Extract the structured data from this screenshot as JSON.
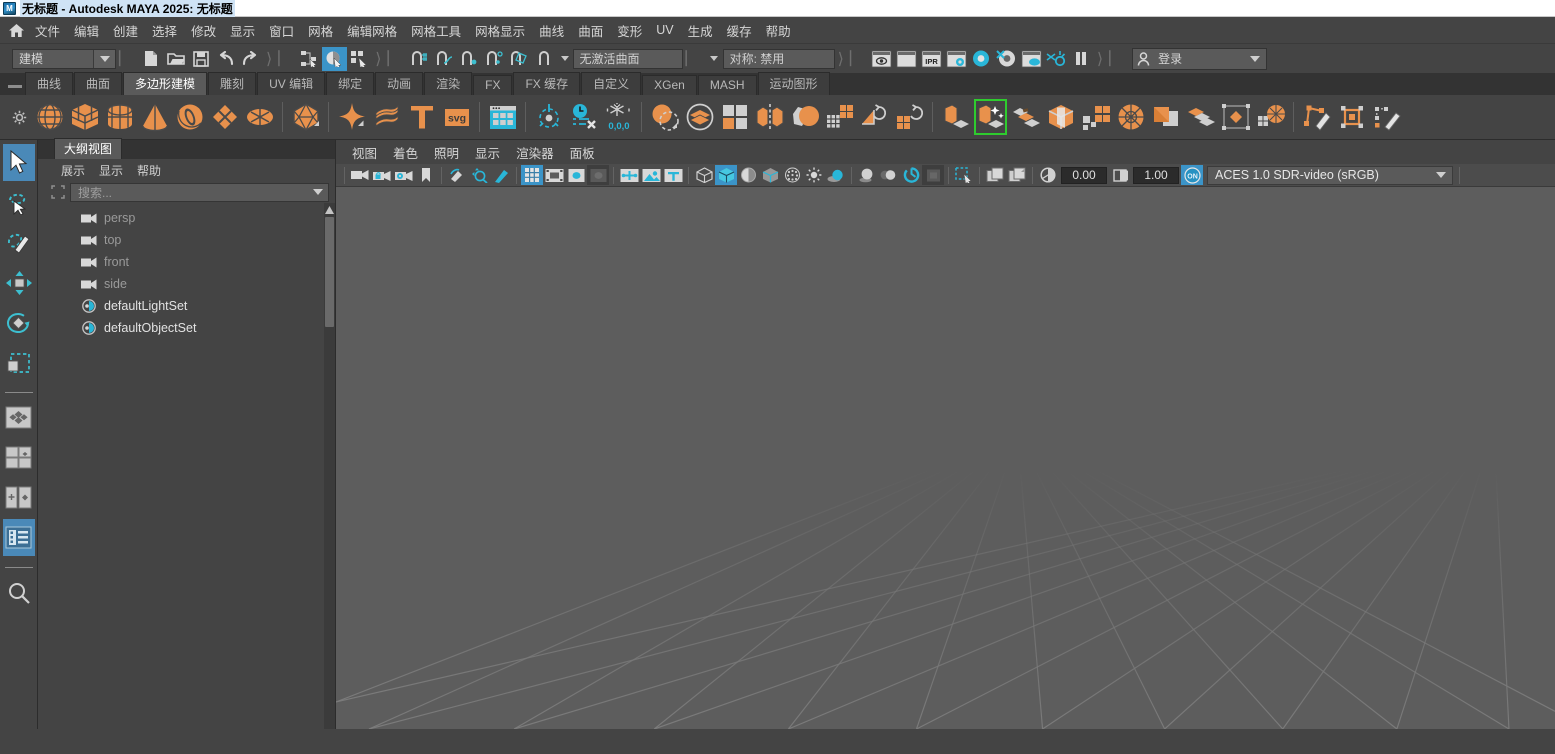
{
  "window": {
    "title": "无标题 - Autodesk MAYA 2025: 无标题",
    "app_icon": "maya-icon"
  },
  "menubar": {
    "home_icon": "home-icon",
    "items": [
      {
        "label": "文件"
      },
      {
        "label": "编辑"
      },
      {
        "label": "创建"
      },
      {
        "label": "选择"
      },
      {
        "label": "修改"
      },
      {
        "label": "显示"
      },
      {
        "label": "窗口"
      },
      {
        "label": "网格"
      },
      {
        "label": "编辑网格"
      },
      {
        "label": "网格工具"
      },
      {
        "label": "网格显示"
      },
      {
        "label": "曲线"
      },
      {
        "label": "曲面"
      },
      {
        "label": "变形"
      },
      {
        "label": "UV"
      },
      {
        "label": "生成"
      },
      {
        "label": "缓存"
      },
      {
        "label": "帮助"
      }
    ]
  },
  "statusbar": {
    "mode_selector": {
      "value": "建模",
      "icon": "chevron-down-icon"
    },
    "file_buttons": [
      {
        "name": "new-scene-button",
        "icon": "new-file-icon"
      },
      {
        "name": "open-scene-button",
        "icon": "open-folder-icon"
      },
      {
        "name": "save-scene-button",
        "icon": "save-disk-icon"
      },
      {
        "name": "undo-button",
        "icon": "undo-arrow-icon"
      },
      {
        "name": "redo-button",
        "icon": "redo-arrow-icon"
      }
    ],
    "selection_mask_buttons": [
      {
        "name": "select-by-hierarchy-button",
        "icon": "hierarchy-select-icon",
        "active": false
      },
      {
        "name": "select-by-object-type-button",
        "icon": "object-select-icon",
        "active": true
      },
      {
        "name": "select-by-component-type-button",
        "icon": "component-select-icon",
        "active": false
      }
    ],
    "snap_buttons": [
      {
        "name": "snap-to-grid-button",
        "icon": "snap-grid-icon"
      },
      {
        "name": "snap-to-curve-button",
        "icon": "snap-curve-icon"
      },
      {
        "name": "snap-to-point-button",
        "icon": "snap-point-icon"
      },
      {
        "name": "snap-to-projected-center-button",
        "icon": "snap-projected-center-icon"
      },
      {
        "name": "snap-to-view-plane-button",
        "icon": "snap-view-plane-icon"
      },
      {
        "name": "make-live-button",
        "icon": "make-live-icon"
      }
    ],
    "live_surface_value": "无激活曲面",
    "symmetry_value": "对称: 禁用",
    "render_buttons": [
      {
        "name": "render-current-frame-button",
        "icon": "render-eye-icon"
      },
      {
        "name": "redo-previous-render-button",
        "icon": "render-blank-icon"
      },
      {
        "name": "ipr-render-button",
        "icon": "ipr-icon"
      },
      {
        "name": "render-settings-button",
        "icon": "render-settings-icon"
      },
      {
        "name": "hypershade-button",
        "icon": "hypershade-icon"
      },
      {
        "name": "render-view-button",
        "icon": "render-view-icon"
      },
      {
        "name": "render-setup-button",
        "icon": "render-setup-icon"
      },
      {
        "name": "toggle-light-linking-button",
        "icon": "light-link-icon"
      },
      {
        "name": "pause-viewport-button",
        "icon": "pause-icon"
      }
    ],
    "account": {
      "label": "登录",
      "icon": "person-icon",
      "caret": "chevron-down-icon"
    }
  },
  "shelf": {
    "grip_icon": "shelf-grip-icon",
    "gear_icon": "gear-icon",
    "tabs": [
      {
        "label": "曲线",
        "active": false
      },
      {
        "label": "曲面",
        "active": false
      },
      {
        "label": "多边形建模",
        "active": true
      },
      {
        "label": "雕刻",
        "active": false
      },
      {
        "label": "UV 编辑",
        "active": false
      },
      {
        "label": "绑定",
        "active": false
      },
      {
        "label": "动画",
        "active": false
      },
      {
        "label": "渲染",
        "active": false
      },
      {
        "label": "FX",
        "active": false
      },
      {
        "label": "FX 缓存",
        "active": false
      },
      {
        "label": "自定义",
        "active": false
      },
      {
        "label": "XGen",
        "active": false
      },
      {
        "label": "MASH",
        "active": false
      },
      {
        "label": "运动图形",
        "active": false
      }
    ],
    "items": [
      {
        "name": "poly-sphere-button",
        "icon": "sphere-icon",
        "group": 1
      },
      {
        "name": "poly-cube-button",
        "icon": "cube-icon",
        "group": 1
      },
      {
        "name": "poly-cylinder-button",
        "icon": "cylinder-icon",
        "group": 1
      },
      {
        "name": "poly-cone-button",
        "icon": "cone-icon",
        "group": 1
      },
      {
        "name": "poly-torus-button",
        "icon": "torus-icon",
        "group": 1
      },
      {
        "name": "poly-plane-button",
        "icon": "plane-icon",
        "group": 1
      },
      {
        "name": "poly-disc-button",
        "icon": "disc-icon",
        "group": 1
      },
      {
        "name": "poly-platonic-button",
        "icon": "platonic-solid-icon",
        "group": 2
      },
      {
        "name": "poly-super-shape-button",
        "icon": "sparkle-icon",
        "group": 3
      },
      {
        "name": "poly-helix-button",
        "icon": "helix-icon",
        "group": 3
      },
      {
        "name": "poly-type-button",
        "icon": "text-type-icon",
        "group": 3
      },
      {
        "name": "poly-svg-button",
        "icon": "svg-icon",
        "group": 3
      },
      {
        "name": "modeling-toolkit-button",
        "icon": "toolkit-panel-icon",
        "group": 4
      },
      {
        "name": "center-pivot-button",
        "icon": "center-pivot-icon",
        "group": 5
      },
      {
        "name": "delete-history-button",
        "icon": "delete-history-icon",
        "group": 5
      },
      {
        "name": "freeze-transform-button",
        "icon": "freeze-transform-icon",
        "group": 5
      },
      {
        "name": "boolean-button",
        "icon": "boolean-icon",
        "group": 6
      },
      {
        "name": "combine-button",
        "icon": "combine-icon",
        "group": 6
      },
      {
        "name": "separate-button",
        "icon": "separate-icon",
        "group": 6
      },
      {
        "name": "mirror-button",
        "icon": "mirror-icon",
        "group": 6
      },
      {
        "name": "smooth-button",
        "icon": "smooth-icon",
        "group": 6
      },
      {
        "name": "reduce-button",
        "icon": "reduce-icon",
        "group": 6
      },
      {
        "name": "remesh-button",
        "icon": "remesh-icon",
        "group": 6
      },
      {
        "name": "retopologize-button",
        "icon": "retopologize-icon",
        "group": 6
      },
      {
        "name": "extrude-button",
        "icon": "extrude-icon",
        "group": 7
      },
      {
        "name": "multi-cut-button",
        "icon": "multicut-icon",
        "group": 7,
        "highlighted": true
      },
      {
        "name": "bevel-button",
        "icon": "bevel-icon",
        "group": 7
      },
      {
        "name": "bridge-button",
        "icon": "bridge-icon",
        "group": 7
      },
      {
        "name": "append-polygon-button",
        "icon": "append-polygon-icon",
        "group": 7
      },
      {
        "name": "circularize-button",
        "icon": "circularize-icon",
        "group": 7
      },
      {
        "name": "merge-button",
        "icon": "merge-icon",
        "group": 7
      },
      {
        "name": "collapse-button",
        "icon": "collapse-icon",
        "group": 7
      },
      {
        "name": "target-weld-button",
        "icon": "target-weld-icon",
        "group": 7
      },
      {
        "name": "connect-button",
        "icon": "connect-icon",
        "group": 7
      },
      {
        "name": "quad-draw-button",
        "icon": "quad-draw-icon",
        "group": 8
      },
      {
        "name": "crease-tool-button",
        "icon": "crease-tool-icon",
        "group": 8
      },
      {
        "name": "sculpt-tool-button",
        "icon": "sculpt-pencil-icon",
        "group": 8
      }
    ]
  },
  "toolbox": {
    "items": [
      {
        "name": "select-tool",
        "icon": "arrow-cursor-icon",
        "selected": true
      },
      {
        "name": "lasso-select-tool",
        "icon": "lasso-select-icon",
        "selected": false
      },
      {
        "name": "paint-select-tool",
        "icon": "paint-select-icon",
        "selected": false
      },
      {
        "name": "move-tool",
        "icon": "move-arrows-icon",
        "selected": false
      },
      {
        "name": "rotate-tool",
        "icon": "rotate-circle-icon",
        "selected": false
      },
      {
        "name": "scale-tool",
        "icon": "scale-box-icon",
        "selected": false
      },
      {
        "name": "last-tool-used",
        "icon": "last-tool-icon",
        "selected": false
      },
      {
        "name": "single-pane-layout",
        "icon": "single-pane-icon",
        "selected": false
      },
      {
        "name": "four-pane-layout",
        "icon": "four-pane-icon",
        "selected": false
      },
      {
        "name": "two-pane-layout",
        "icon": "two-pane-icon",
        "selected": false
      },
      {
        "name": "persp-outliner-layout",
        "icon": "persp-outliner-icon",
        "selected": true
      },
      {
        "name": "search-layout",
        "icon": "search-icon",
        "selected": false
      }
    ]
  },
  "outliner": {
    "tab_label": "大纲视图",
    "menus": [
      {
        "label": "展示"
      },
      {
        "label": "显示"
      },
      {
        "label": "帮助"
      }
    ],
    "search": {
      "placeholder": "搜索...",
      "pin_icon": "pin-selection-icon",
      "caret": "chevron-down-icon"
    },
    "nodes": [
      {
        "name": "persp",
        "icon": "camera-icon",
        "style": "dim"
      },
      {
        "name": "top",
        "icon": "camera-icon",
        "style": "dim"
      },
      {
        "name": "front",
        "icon": "camera-icon",
        "style": "dim"
      },
      {
        "name": "side",
        "icon": "camera-icon",
        "style": "dim"
      },
      {
        "name": "defaultLightSet",
        "icon": "set-icon",
        "style": "bright"
      },
      {
        "name": "defaultObjectSet",
        "icon": "set-icon",
        "style": "bright"
      }
    ],
    "scrollbar": {
      "name": "outliner-scrollbar"
    }
  },
  "viewport": {
    "menus": [
      {
        "label": "视图"
      },
      {
        "label": "着色"
      },
      {
        "label": "照明"
      },
      {
        "label": "显示"
      },
      {
        "label": "渲染器"
      },
      {
        "label": "面板"
      }
    ],
    "toolbar": [
      {
        "name": "select-camera-button",
        "icon": "camera-icon",
        "state": "normal"
      },
      {
        "name": "lock-camera-button",
        "icon": "camera-lock-icon",
        "state": "normal"
      },
      {
        "name": "camera-attributes-button",
        "icon": "camera-settings-icon",
        "state": "normal"
      },
      {
        "name": "bookmark-button",
        "icon": "bookmark-icon",
        "state": "normal"
      },
      {
        "name": "image-plane-button",
        "icon": "image-plane-icon",
        "state": "normal"
      },
      {
        "name": "two-d-pan-zoom-button",
        "icon": "pan-zoom-icon",
        "state": "normal"
      },
      {
        "name": "grease-pencil-button",
        "icon": "grease-pencil-icon",
        "state": "normal"
      },
      {
        "name": "grid-toggle-button",
        "icon": "grid-icon",
        "state": "on"
      },
      {
        "name": "film-gate-button",
        "icon": "film-gate-icon",
        "state": "normal"
      },
      {
        "name": "resolution-gate-button",
        "icon": "resolution-gate-icon",
        "state": "normal"
      },
      {
        "name": "gate-mask-button",
        "icon": "gate-mask-icon",
        "state": "dark"
      },
      {
        "name": "xray-joints-button",
        "icon": "xray-joints-icon",
        "state": "normal"
      },
      {
        "name": "image-plane-display-button",
        "icon": "image-display-icon",
        "state": "normal"
      },
      {
        "name": "hud-text-button",
        "icon": "hud-text-icon",
        "state": "normal"
      },
      {
        "name": "wireframe-button",
        "icon": "wireframe-cube-icon",
        "state": "normal"
      },
      {
        "name": "smooth-shade-button",
        "icon": "shaded-cube-icon",
        "state": "on"
      },
      {
        "name": "shaded-wireframe-button",
        "icon": "shaded-wire-icon",
        "state": "normal"
      },
      {
        "name": "xray-button",
        "icon": "xray-cube-icon",
        "state": "normal"
      },
      {
        "name": "textured-button",
        "icon": "textured-icon",
        "state": "normal"
      },
      {
        "name": "use-lights-button",
        "icon": "light-bulb-icon",
        "state": "normal"
      },
      {
        "name": "shadows-button",
        "icon": "shadows-icon",
        "state": "normal"
      },
      {
        "name": "ambient-occlusion-button",
        "icon": "ao-sphere-icon",
        "state": "normal"
      },
      {
        "name": "motion-blur-button",
        "icon": "motion-blur-icon",
        "state": "normal"
      },
      {
        "name": "anti-alias-button",
        "icon": "anti-alias-icon",
        "state": "normal"
      },
      {
        "name": "multisample-button",
        "icon": "multisample-icon",
        "state": "dark"
      },
      {
        "name": "isolate-select-button",
        "icon": "isolate-select-icon",
        "state": "normal"
      },
      {
        "name": "x-ray-display-button",
        "icon": "panel-copy-icon",
        "state": "normal"
      },
      {
        "name": "panel-duplicate-button",
        "icon": "panel-duplicate-icon",
        "state": "normal"
      },
      {
        "name": "panel-tear-off-button",
        "icon": "panel-tearoff-icon",
        "state": "normal"
      }
    ],
    "exposure_value": "0.00",
    "gamma_value": "1.00",
    "color_management_enabled_icon": "color-management-on-icon",
    "color_profile": "ACES 1.0 SDR-video (sRGB)",
    "color_profile_caret": "chevron-down-icon"
  },
  "colors": {
    "accent_blue": "#3b94c8",
    "shelf_orange": "#e8914c",
    "highlight_green": "#2ecc2e",
    "viewport_bg": "#5d5d5d",
    "grid_line": "#6e6e6e",
    "panel_bg": "#444444"
  }
}
